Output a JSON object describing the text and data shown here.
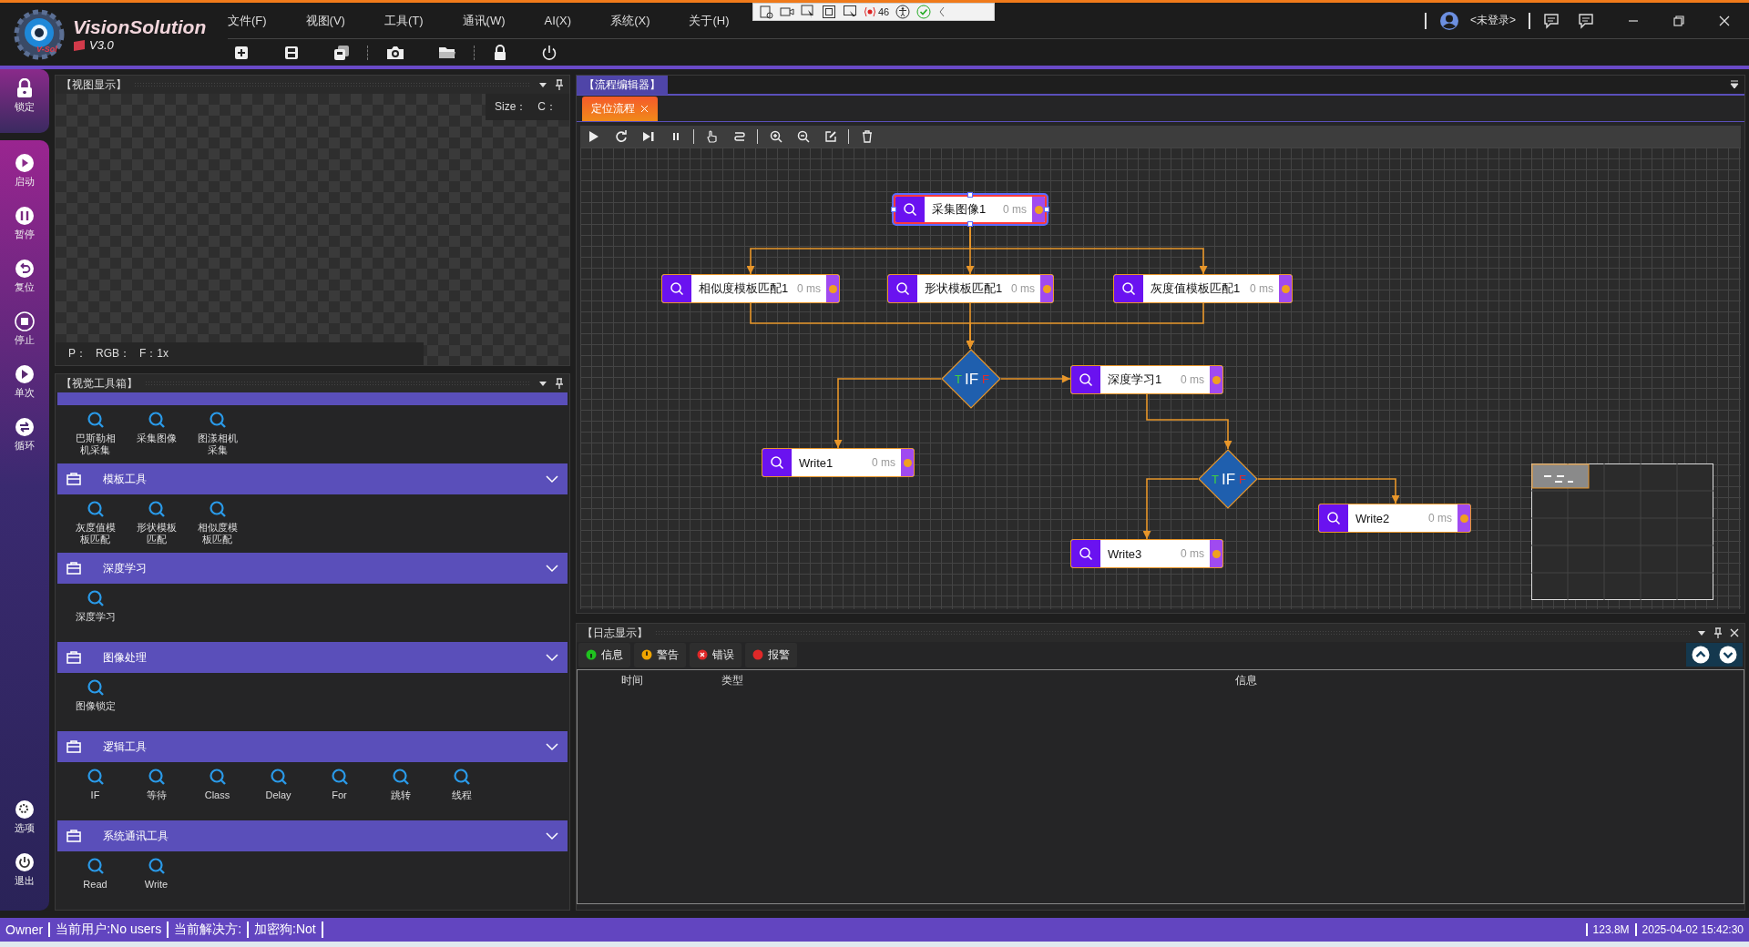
{
  "app": {
    "title": "VisionSolution",
    "version": "V3.0",
    "logo_text": "V-Sol"
  },
  "menu": [
    "文件(F)",
    "视图(V)",
    "工具(T)",
    "通讯(W)",
    "AI(X)",
    "系统(X)",
    "关于(H)"
  ],
  "recorder_toolbar": {
    "counter": "46"
  },
  "user": {
    "name": "<未登录>"
  },
  "sidebar": {
    "top": [
      {
        "label": "锁定"
      }
    ],
    "items": [
      {
        "label": "启动"
      },
      {
        "label": "暂停"
      },
      {
        "label": "复位"
      },
      {
        "label": "停止"
      },
      {
        "label": "单次"
      },
      {
        "label": "循环"
      }
    ],
    "bottom": [
      {
        "label": "选项"
      },
      {
        "label": "退出"
      }
    ]
  },
  "view_panel": {
    "title": "【视图显示】",
    "size_label": "Size：",
    "channel_label": "C：",
    "pixel_label": "P：",
    "rgb_label": "RGB：",
    "zoom_label": "F：1x"
  },
  "toolbox": {
    "title": "【视觉工具箱】",
    "groups": [
      {
        "expanded": true,
        "tools": [
          "巴斯勒相机采集",
          "采集图像",
          "图漾相机采集"
        ]
      },
      {
        "name": "模板工具",
        "expanded": true,
        "tools": [
          "灰度值模板匹配",
          "形状模板匹配",
          "相似度模板匹配"
        ]
      },
      {
        "name": "深度学习",
        "expanded": true,
        "tools": [
          "深度学习"
        ]
      },
      {
        "name": "图像处理",
        "expanded": true,
        "tools": [
          "图像锁定"
        ]
      },
      {
        "name": "逻辑工具",
        "expanded": true,
        "tools": [
          "IF",
          "等待",
          "Class",
          "Delay",
          "For",
          "跳转",
          "线程"
        ]
      },
      {
        "name": "系统通讯工具",
        "expanded": true,
        "tools": [
          "Read",
          "Write"
        ]
      }
    ]
  },
  "flow_editor": {
    "title": "【流程编辑器】",
    "tabs": [
      {
        "label": "定位流程",
        "selected": true
      }
    ],
    "nodes": [
      {
        "kind": "tool",
        "label": "采集图像1",
        "time": "0 ms",
        "selected": true
      },
      {
        "kind": "tool",
        "label": "相似度模板匹配1",
        "time": "0 ms",
        "selected": false
      },
      {
        "kind": "tool",
        "label": "形状模板匹配1",
        "time": "0 ms",
        "selected": false
      },
      {
        "kind": "tool",
        "label": "灰度值模板匹配1",
        "time": "0 ms",
        "selected": false
      },
      {
        "kind": "condition",
        "label": "IF",
        "true_label": "T",
        "false_label": "F"
      },
      {
        "kind": "tool",
        "label": "深度学习1",
        "time": "0 ms",
        "selected": false
      },
      {
        "kind": "tool",
        "label": "Write1",
        "time": "0 ms",
        "selected": false
      },
      {
        "kind": "condition",
        "label": "IF",
        "true_label": "T",
        "false_label": "F"
      },
      {
        "kind": "tool",
        "label": "Write2",
        "time": "0 ms",
        "selected": false
      },
      {
        "kind": "tool",
        "label": "Write3",
        "time": "0 ms",
        "selected": false
      }
    ]
  },
  "log": {
    "title": "【日志显示】",
    "filters": [
      {
        "kind": "info",
        "label": "信息"
      },
      {
        "kind": "warning",
        "label": "警告"
      },
      {
        "kind": "error",
        "label": "错误"
      },
      {
        "kind": "alarm",
        "label": "报警"
      }
    ],
    "columns": [
      "时间",
      "类型",
      "信息"
    ]
  },
  "status_bar": {
    "items": [
      "Owner",
      "当前用户:No users",
      "当前解决方:",
      "加密狗:Not"
    ],
    "memory": "123.8M",
    "datetime": "2025-04-02 15:42:30"
  }
}
